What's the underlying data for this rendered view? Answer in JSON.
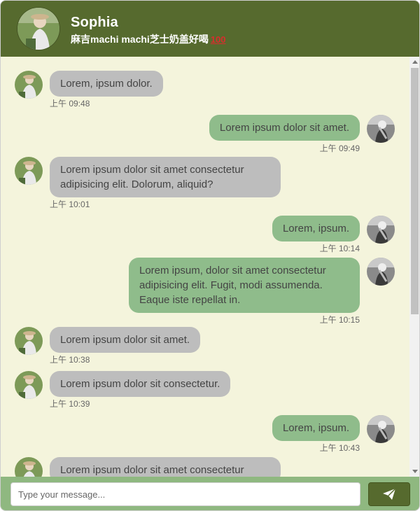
{
  "header": {
    "name": "Sophia",
    "status": "麻吉machi machi芝士奶盖好喝",
    "status_emoji": "100",
    "avatar": "contact-avatar"
  },
  "messages": [
    {
      "side": "in",
      "text": "Lorem, ipsum dolor.",
      "time": "上午 09:48"
    },
    {
      "side": "out",
      "text": "Lorem ipsum dolor sit amet.",
      "time": "上午 09:49"
    },
    {
      "side": "in",
      "text": "Lorem ipsum dolor sit amet consectetur adipisicing elit. Dolorum, aliquid?",
      "time": "上午 10:01"
    },
    {
      "side": "out",
      "text": "Lorem, ipsum.",
      "time": "上午 10:14"
    },
    {
      "side": "out",
      "text": "Lorem ipsum, dolor sit amet consectetur adipisicing elit. Fugit, modi assumenda. Eaque iste repellat in.",
      "time": "上午 10:15"
    },
    {
      "side": "in",
      "text": "Lorem ipsum dolor sit amet.",
      "time": "上午 10:38"
    },
    {
      "side": "in",
      "text": "Lorem ipsum dolor sit consectetur.",
      "time": "上午 10:39"
    },
    {
      "side": "out",
      "text": "Lorem, ipsum.",
      "time": "上午 10:43"
    },
    {
      "side": "in",
      "text": "Lorem ipsum dolor sit amet consectetur",
      "time": ""
    }
  ],
  "composer": {
    "placeholder": "Type your message...",
    "send_icon": "paper-plane-icon"
  },
  "colors": {
    "header_bg": "#566a2e",
    "chat_bg": "#f4f4dc",
    "incoming_bubble": "#bdbdbd",
    "outgoing_bubble": "#8fbc8b",
    "footer_bg": "#8fb880"
  }
}
